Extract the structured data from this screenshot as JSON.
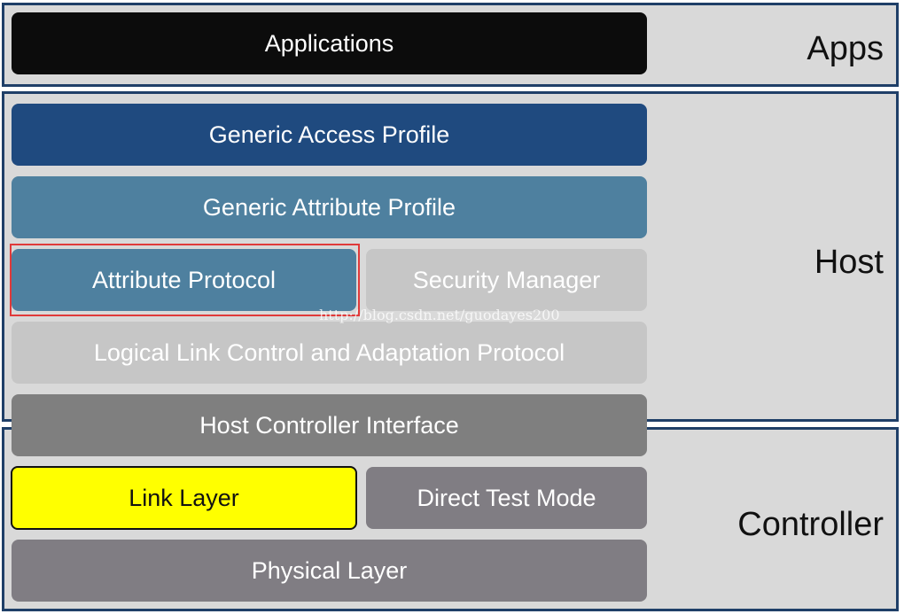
{
  "sections": {
    "apps": {
      "label": "Apps"
    },
    "host": {
      "label": "Host"
    },
    "controller": {
      "label": "Controller"
    }
  },
  "blocks": {
    "applications": "Applications",
    "gap": "Generic Access Profile",
    "gatt": "Generic Attribute Profile",
    "att": "Attribute Protocol",
    "sm": "Security Manager",
    "l2cap": "Logical Link Control and Adaptation Protocol",
    "hci": "Host Controller Interface",
    "ll": "Link Layer",
    "dtm": "Direct Test Mode",
    "phy": "Physical Layer"
  },
  "watermark": "http://blog.csdn.net/guodayes200",
  "colors": {
    "frame_border": "#1f3f68",
    "section_bg": "#d9d9d9",
    "applications": "#0c0c0c",
    "gap": "#1f4a7f",
    "gatt_att": "#4e809f",
    "sm_l2cap": "#c6c6c6",
    "hci": "#7f7f7f",
    "dtm_phy": "#807d83",
    "link_layer": "#ffff00",
    "highlight": "#e03a3a"
  }
}
